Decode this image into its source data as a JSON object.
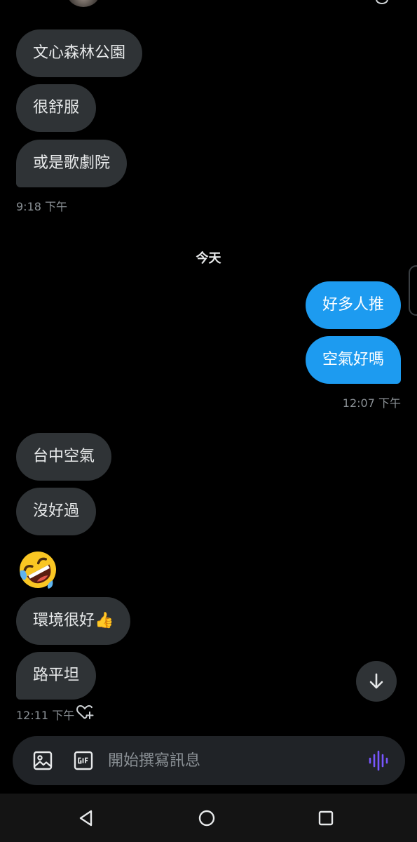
{
  "messages_earlier": [
    {
      "text": "文心森林公園"
    },
    {
      "text": "很舒服"
    },
    {
      "text": "或是歌劇院"
    }
  ],
  "timestamp_1": "9:18 下午",
  "day_separator": "今天",
  "sent": [
    {
      "text": "好多人推"
    },
    {
      "text": "空氣好嗎"
    }
  ],
  "timestamp_2": "12:07 下午",
  "received": [
    {
      "text": "台中空氣"
    },
    {
      "text": "沒好過"
    },
    {
      "text": "環境很好👍"
    },
    {
      "text": "路平坦"
    }
  ],
  "emoji_message": "rolling-on-floor-laughing-emoji",
  "timestamp_3": "12:11 下午",
  "composer": {
    "placeholder": "開始撰寫訊息",
    "image_icon": "image-icon",
    "gif_icon": "gif-icon",
    "voice_icon": "voice-message-icon"
  },
  "colors": {
    "background": "#000000",
    "incoming_bubble": "#2f3336",
    "outgoing_bubble": "#1d9bf0",
    "voice_accent": "#7856ff"
  }
}
